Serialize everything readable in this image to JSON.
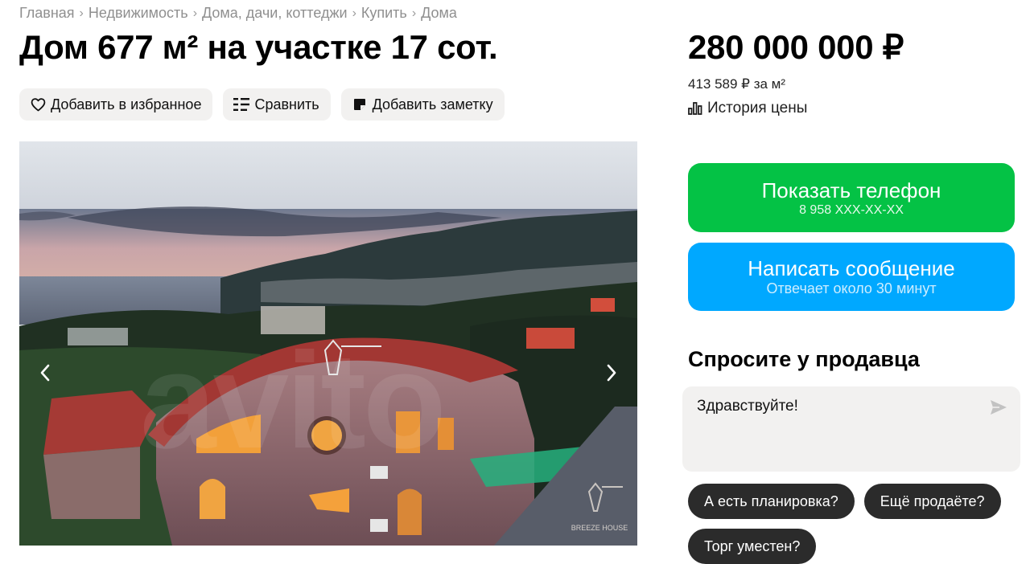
{
  "breadcrumbs": [
    "Главная",
    "Недвижимость",
    "Дома, дачи, коттеджи",
    "Купить",
    "Дома"
  ],
  "title": "Дом 677 м² на участке 17 сот.",
  "actions": {
    "favorite": "Добавить в избранное",
    "compare": "Сравнить",
    "note": "Добавить заметку"
  },
  "gallery": {
    "watermark": "avito",
    "logo_text": "BREEZE HOUSE"
  },
  "price": {
    "total": "280 000 000 ₽",
    "per_meter": "413 589 ₽ за м²",
    "history_label": "История цены"
  },
  "contact": {
    "phone_label": "Показать телефон",
    "phone_masked": "8 958 XXX-XX-XX",
    "message_label": "Написать сообщение",
    "message_sub": "Отвечает около 30 минут"
  },
  "ask": {
    "title": "Спросите у продавца",
    "message": "Здравствуйте!",
    "chips": [
      "А есть планировка?",
      "Ещё продаёте?",
      "Торг уместен?"
    ]
  },
  "colors": {
    "phone_button": "#04c245",
    "message_button": "#00a8ff",
    "chip_bg": "#2b2b2b",
    "action_bg": "#f2f1f0"
  }
}
